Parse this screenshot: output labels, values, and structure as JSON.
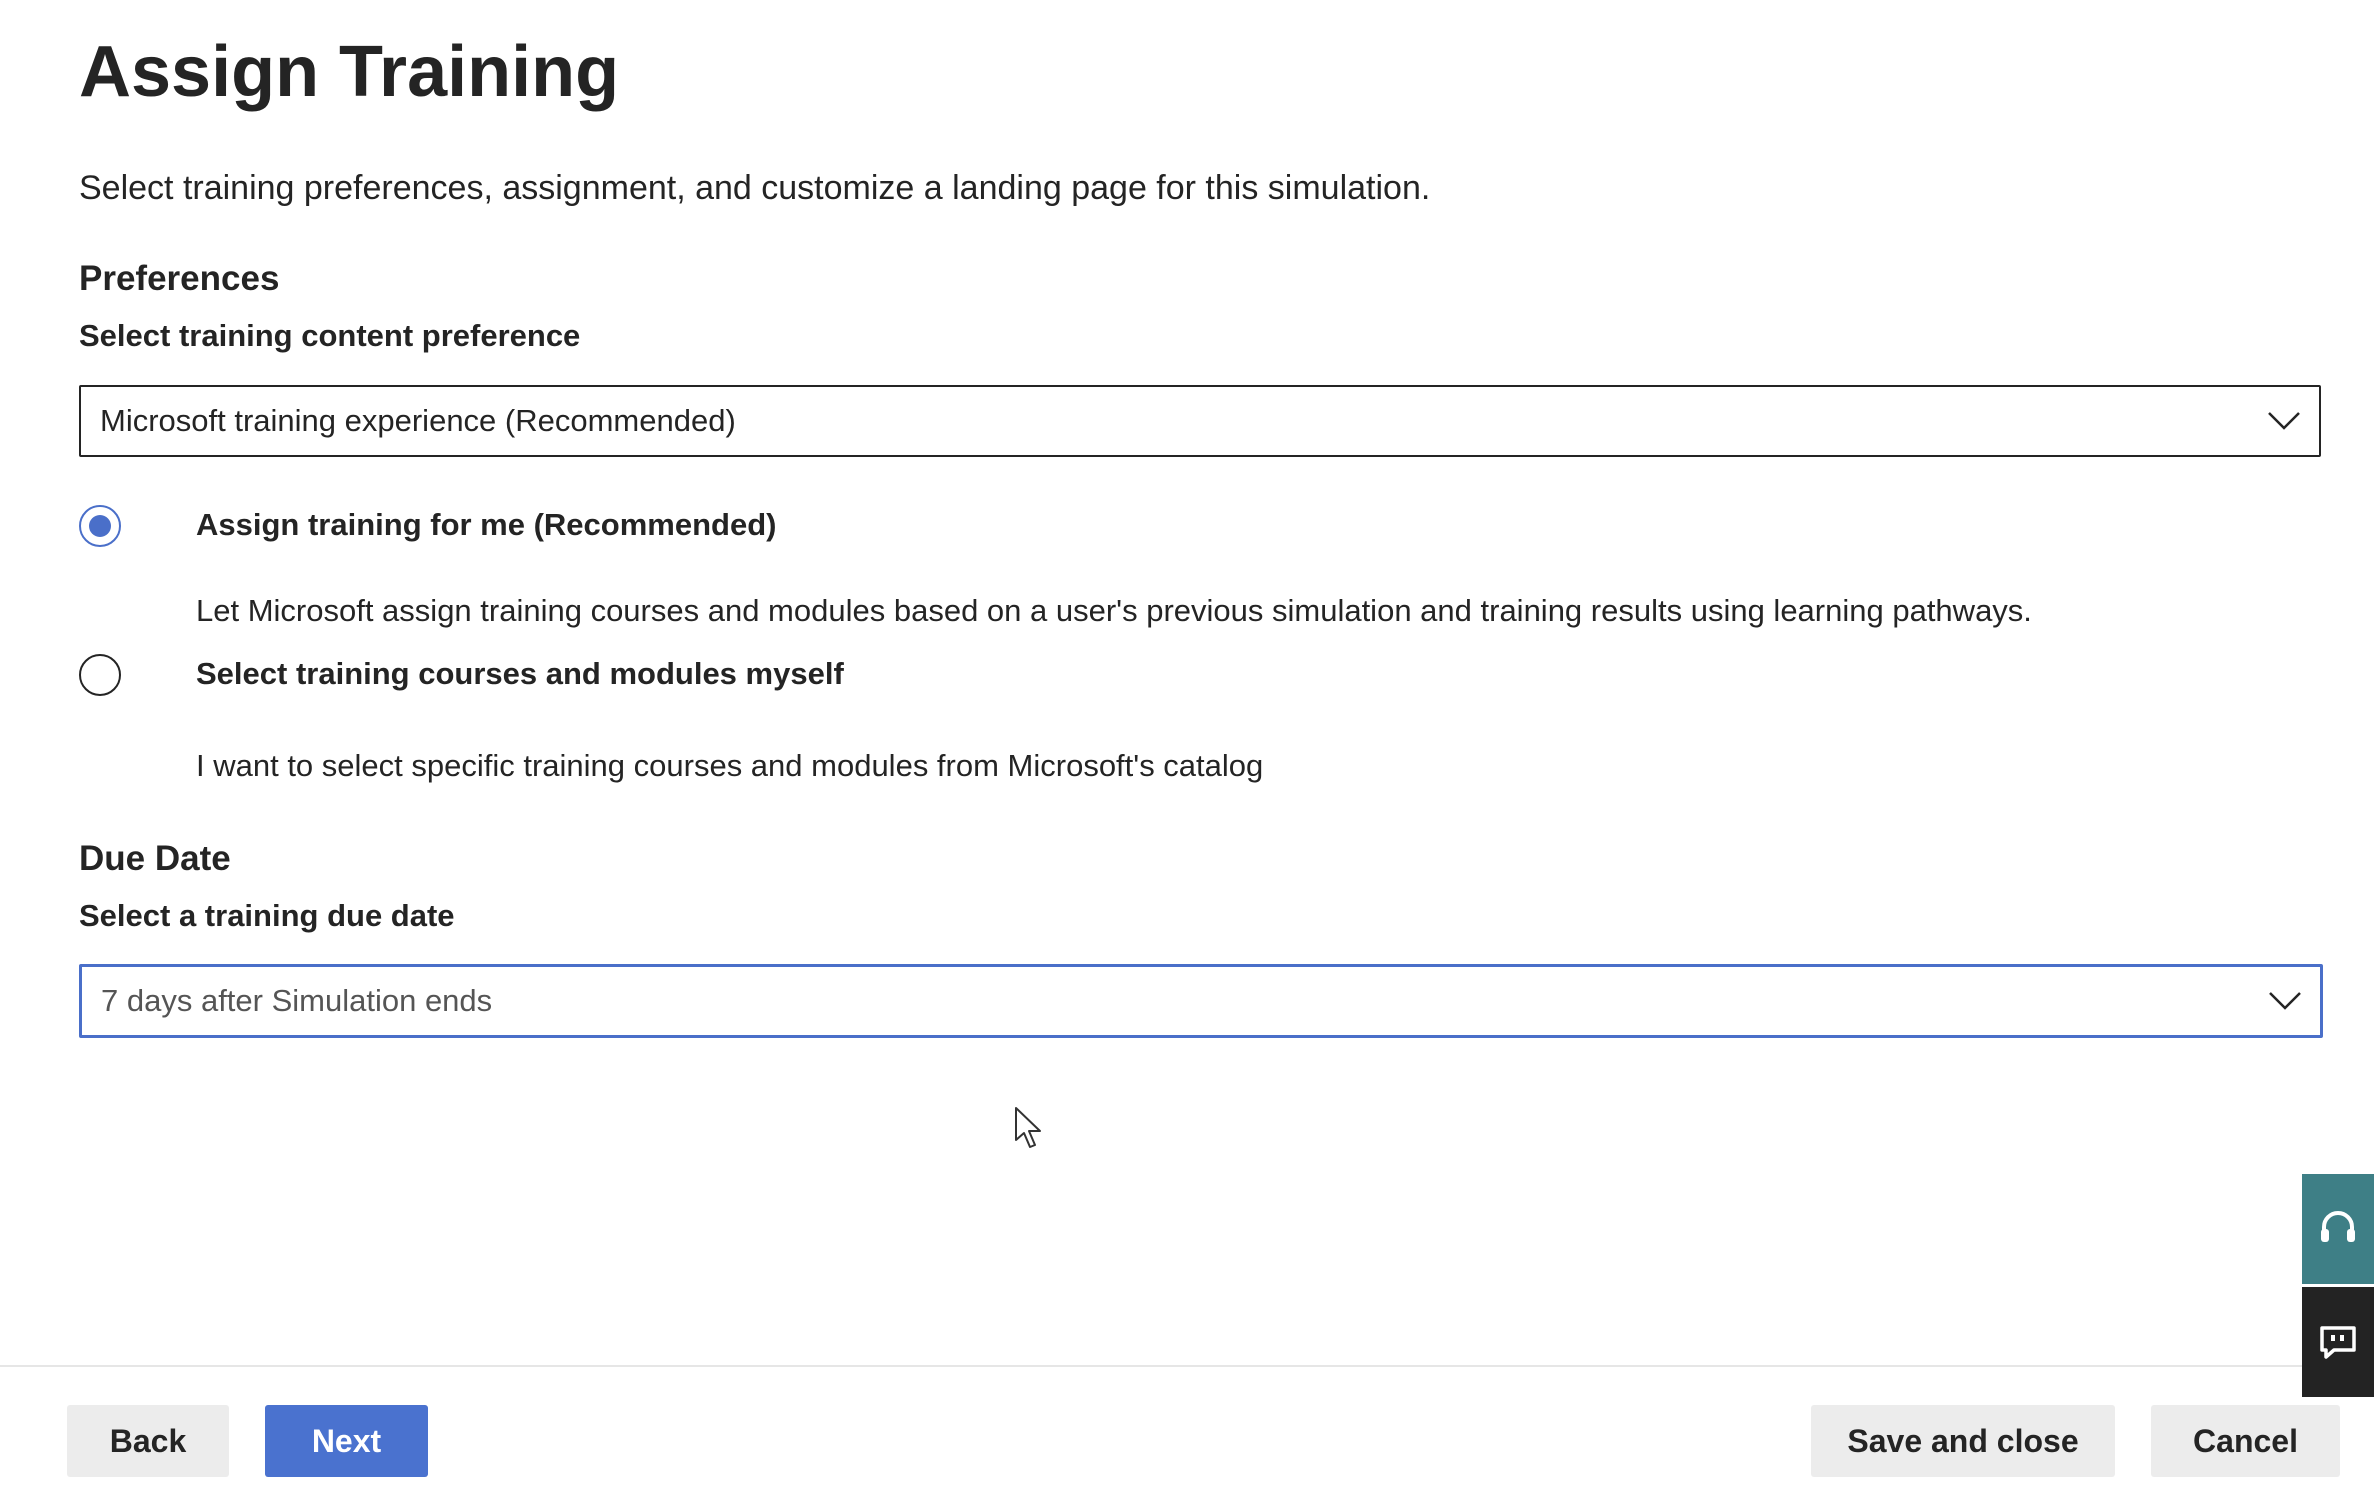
{
  "page": {
    "title": "Assign Training",
    "subtitle": "Select training preferences, assignment, and customize a landing page for this simulation."
  },
  "preferences": {
    "heading": "Preferences",
    "content_label": "Select training content preference",
    "content_selected": "Microsoft training experience (Recommended)"
  },
  "assignment": {
    "options": [
      {
        "label": "Assign training for me (Recommended)",
        "description": "Let Microsoft assign training courses and modules based on a user's previous simulation and training results using learning pathways.",
        "checked": true
      },
      {
        "label": "Select training courses and modules myself",
        "description": "I want to select specific training courses and modules from Microsoft's catalog",
        "checked": false
      }
    ]
  },
  "due_date": {
    "heading": "Due Date",
    "label": "Select a training due date",
    "selected": "7 days after Simulation ends"
  },
  "footer": {
    "back_label": "Back",
    "next_label": "Next",
    "save_close_label": "Save and close",
    "cancel_label": "Cancel"
  },
  "side_tabs": {
    "help_icon": "headset-icon",
    "feedback_icon": "feedback-icon"
  },
  "colors": {
    "accent": "#4a72cf",
    "help_tab": "#3e7f86",
    "feedback_tab": "#232323"
  }
}
